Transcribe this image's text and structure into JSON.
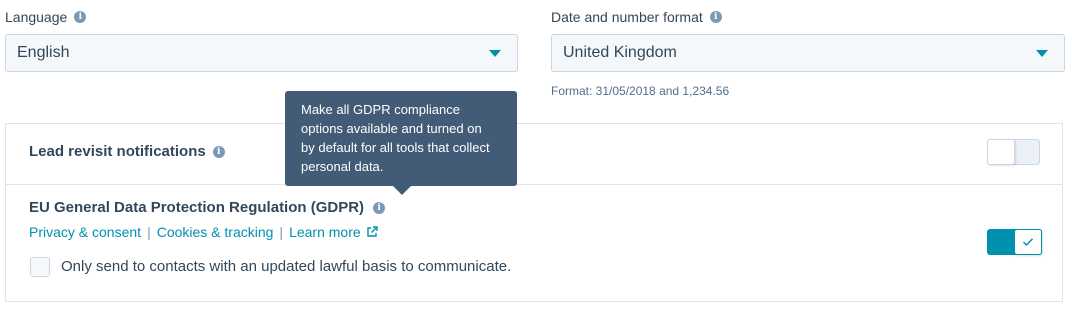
{
  "language": {
    "label": "Language",
    "value": "English",
    "info_icon": "info-icon"
  },
  "date_format": {
    "label": "Date and number format",
    "value": "United Kingdom",
    "hint": "Format: 31/05/2018 and 1,234.56",
    "info_icon": "info-icon"
  },
  "lead_revisit": {
    "title": "Lead revisit notifications",
    "toggle_enabled": false
  },
  "gdpr": {
    "title": "EU General Data Protection Regulation (GDPR)",
    "links": [
      {
        "label": "Privacy & consent"
      },
      {
        "label": "Cookies & tracking"
      },
      {
        "label": "Learn more"
      }
    ],
    "link_separator": "|",
    "checkbox_label": "Only send to contacts with an updated lawful basis to communicate.",
    "checkbox_checked": false,
    "toggle_enabled": true
  },
  "tooltip": {
    "lines": [
      "Make all GDPR compliance",
      "options available and turned on",
      "by default for all tools that collect",
      "personal data."
    ]
  },
  "colors": {
    "accent": "#0091ae",
    "text": "#33475b",
    "tooltip_bg": "#425b76",
    "border": "#cbd6e2",
    "field_bg": "#f5f8fa"
  }
}
